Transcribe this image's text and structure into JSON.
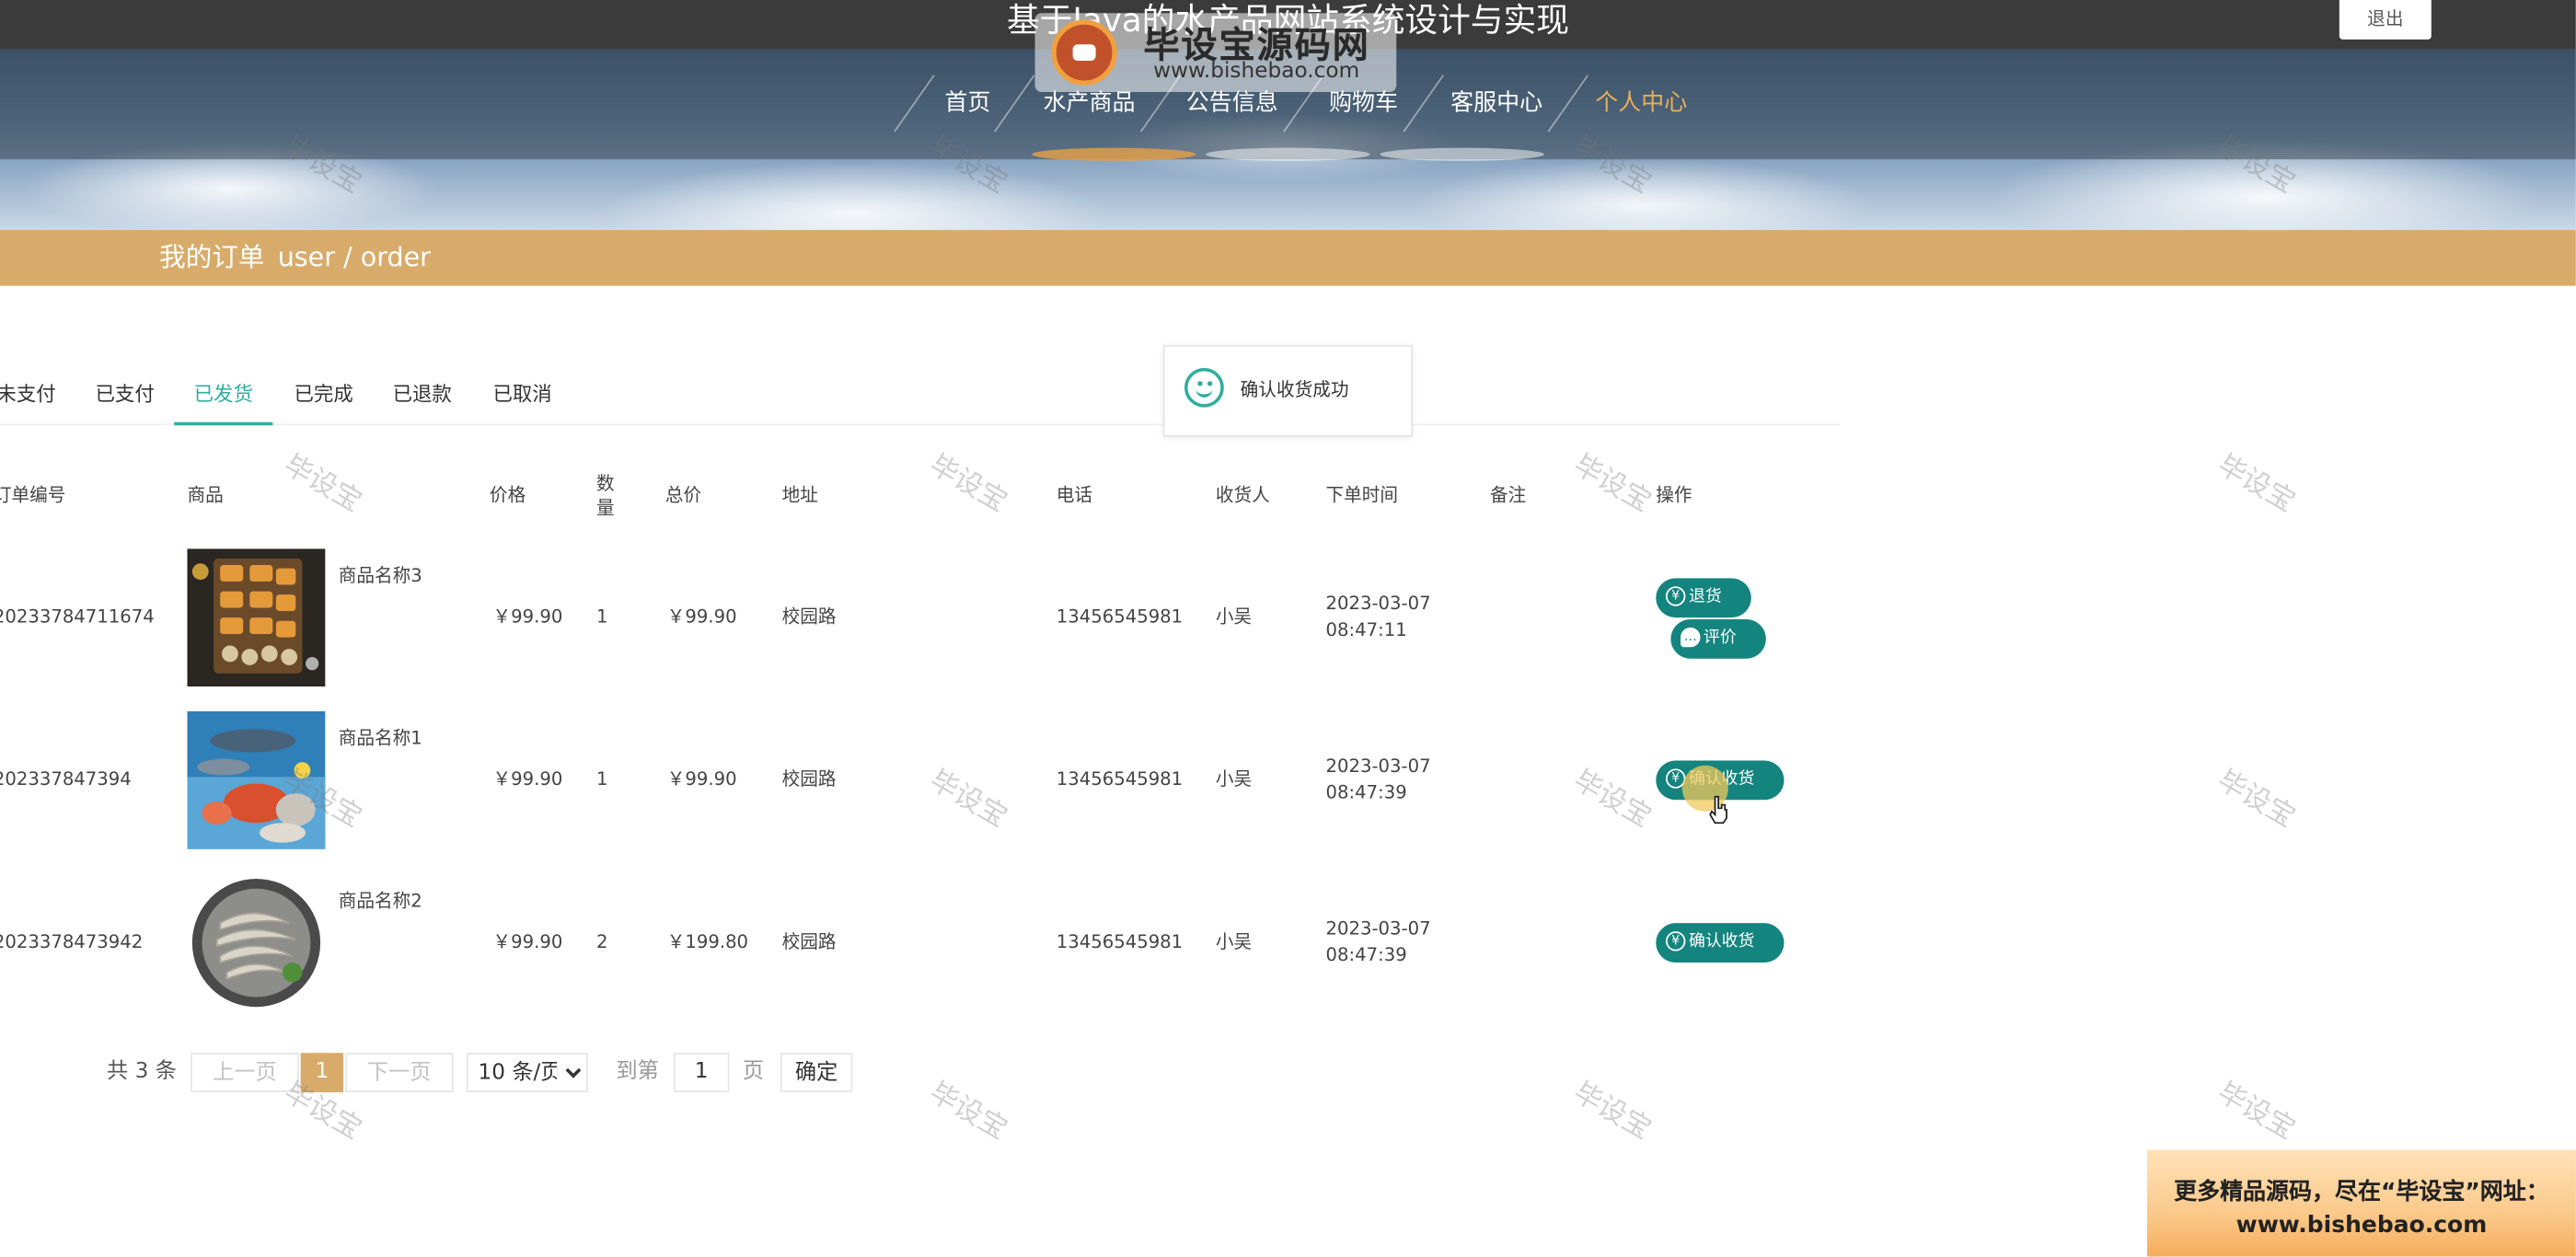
{
  "header": {
    "site_title": "基于Java的水产品网站系统设计与实现",
    "logout_label": "退出",
    "watermark_logo_text": "毕设宝源码网",
    "watermark_logo_url": "www.bishebao.com"
  },
  "nav": {
    "items": [
      {
        "label": "首页"
      },
      {
        "label": "水产商品"
      },
      {
        "label": "公告信息"
      },
      {
        "label": "购物车"
      },
      {
        "label": "客服中心"
      },
      {
        "label": "个人中心",
        "active": true
      }
    ],
    "active_color": "#e8b05a"
  },
  "section": {
    "title": "我的订单",
    "path": "user / order",
    "bar_color": "#d9ab6a"
  },
  "tabs": [
    {
      "label": "未支付"
    },
    {
      "label": "已支付"
    },
    {
      "label": "已发货",
      "active": true
    },
    {
      "label": "已完成"
    },
    {
      "label": "已退款"
    },
    {
      "label": "已取消"
    }
  ],
  "toast": {
    "icon": "smile-icon",
    "message": "确认收货成功"
  },
  "table": {
    "headers": {
      "order_no": "订单编号",
      "product": "商品",
      "price": "价格",
      "qty": "数量",
      "total": "总价",
      "address": "地址",
      "phone": "电话",
      "receiver": "收货人",
      "order_time_label": "下单时间",
      "remark": "备注",
      "ops": "操作"
    },
    "rows": [
      {
        "order_no": "20233784711674",
        "product_name": "商品名称3",
        "image": "seafood-platter",
        "price": "￥99.90",
        "qty": "1",
        "total": "￥99.90",
        "address": "校园路",
        "phone": "13456545981",
        "receiver": "小吴",
        "date": "2023-03-07",
        "time": "08:47:11",
        "remark": "",
        "actions": [
          {
            "label": "退货",
            "icon": "yen-icon"
          },
          {
            "label": "评价",
            "icon": "chat-icon"
          }
        ]
      },
      {
        "order_no": "202337847394",
        "product_name": "商品名称1",
        "image": "seafood-market",
        "price": "￥99.90",
        "qty": "1",
        "total": "￥99.90",
        "address": "校园路",
        "phone": "13456545981",
        "receiver": "小吴",
        "date": "2023-03-07",
        "time": "08:47:39",
        "remark": "",
        "actions": [
          {
            "label": "确认收货",
            "icon": "yen-icon"
          }
        ]
      },
      {
        "order_no": "2023378473942",
        "product_name": "商品名称2",
        "image": "shrimp-plate",
        "price": "￥99.90",
        "qty": "2",
        "total": "￥199.80",
        "address": "校园路",
        "phone": "13456545981",
        "receiver": "小吴",
        "date": "2023-03-07",
        "time": "08:47:39",
        "remark": "",
        "actions": [
          {
            "label": "确认收货",
            "icon": "yen-icon"
          }
        ]
      }
    ],
    "button_color": "#14847f"
  },
  "pagination": {
    "total_text": "共 3 条",
    "prev": "上一页",
    "current": "1",
    "next": "下一页",
    "page_size": "10 条/页",
    "page_size_options": [
      "10 条/页"
    ],
    "goto_prefix": "到第",
    "goto_value": "1",
    "goto_suffix": "页",
    "confirm": "确定"
  },
  "watermark": {
    "text": "毕设宝"
  },
  "ad": {
    "line1": "更多精品源码，尽在“毕设宝”网址：",
    "line2": "www.bishebao.com"
  }
}
